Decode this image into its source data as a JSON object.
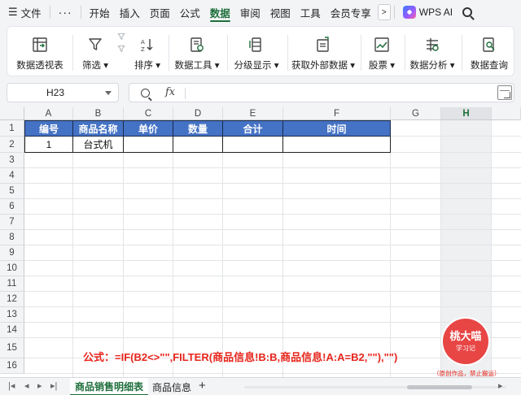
{
  "menu": {
    "file": "文件",
    "more": "···",
    "tabs": [
      "开始",
      "插入",
      "页面",
      "公式",
      "数据",
      "审阅",
      "视图",
      "工具",
      "会员专享"
    ],
    "active_index": 4,
    "wps_ai": "WPS AI"
  },
  "ribbon": {
    "pivot": "数据透视表",
    "filter": "筛选",
    "sort": "排序",
    "data_tools": "数据工具",
    "group": "分级显示",
    "external": "获取外部数据",
    "stocks": "股票",
    "analysis": "数据分析",
    "query": "数据查询"
  },
  "formula_bar": {
    "name_box": "H23",
    "fx": "fx",
    "value": ""
  },
  "sheet": {
    "columns": [
      "A",
      "B",
      "C",
      "D",
      "E",
      "F",
      "G",
      "H"
    ],
    "selected_column": "H",
    "rows": [
      "1",
      "2",
      "3",
      "4",
      "5",
      "6",
      "7",
      "8",
      "9",
      "10",
      "11",
      "12",
      "13",
      "14",
      "15",
      "16"
    ],
    "header_row": [
      "编号",
      "商品名称",
      "单价",
      "数量",
      "合计",
      "时间"
    ],
    "data_row": [
      "1",
      "台式机",
      "",
      "",
      "",
      ""
    ],
    "note": "公式：=IF(B2<>\"\",FILTER(商品信息!B:B,商品信息!A:A=B2,\"\"),\"\")"
  },
  "watermark": {
    "name": "桃大喵",
    "sub": "学习记",
    "note": "（原创作品，禁止搬运）"
  },
  "tabs": {
    "sheets": [
      "商品销售明细表",
      "商品信息"
    ],
    "active": 0,
    "add": "+"
  },
  "colors": {
    "accent": "#1f6f3c",
    "header_fill": "#4472c4",
    "formula_text": "#e8261c",
    "badge": "#e84545"
  }
}
